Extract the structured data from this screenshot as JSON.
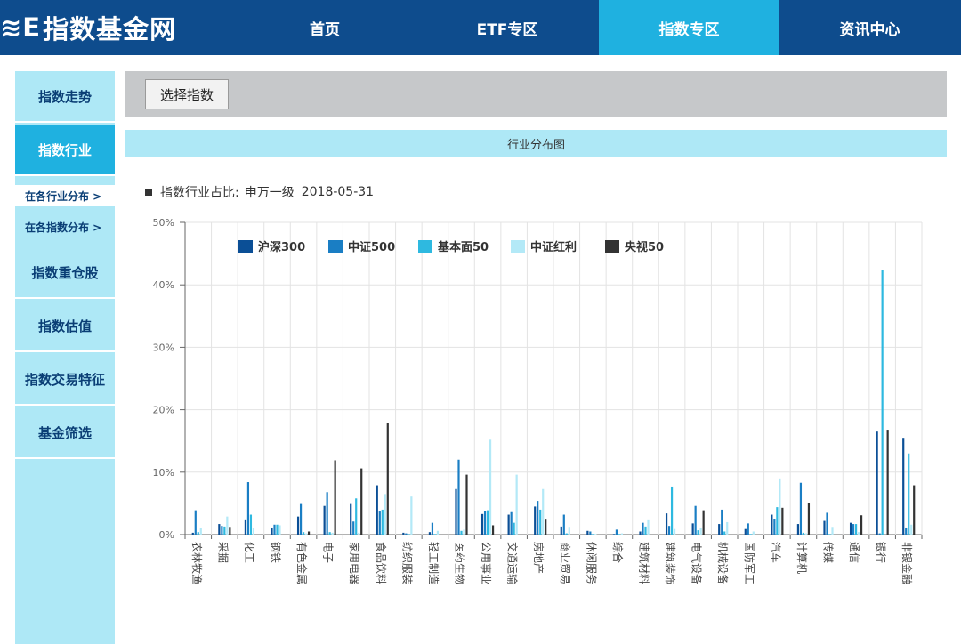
{
  "logo": {
    "mark": "≋E",
    "text": "指数基金网"
  },
  "nav": [
    {
      "label": "首页",
      "active": false
    },
    {
      "label": "ETF专区",
      "active": false
    },
    {
      "label": "指数专区",
      "active": true
    },
    {
      "label": "资讯中心",
      "active": false
    }
  ],
  "sidebar": {
    "items": [
      {
        "label": "指数走势",
        "active": false
      },
      {
        "label": "指数行业",
        "active": true
      },
      {
        "label": "在各行业分布 >",
        "active": true,
        "sub": true
      },
      {
        "label": "在各指数分布 >",
        "active": false,
        "sub": true
      },
      {
        "label": "指数重仓股",
        "active": false
      },
      {
        "label": "指数估值",
        "active": false
      },
      {
        "label": "指数交易特征",
        "active": false
      },
      {
        "label": "基金筛选",
        "active": false
      }
    ]
  },
  "toolbar": {
    "select_label": "选择指数"
  },
  "banner": {
    "title": "行业分布图"
  },
  "subtitle": {
    "label": "指数行业占比:",
    "scheme": "申万一级",
    "date": "2018-05-31"
  },
  "colors": {
    "nav_bg": "#0e4c8d",
    "accent": "#1fb1e0",
    "light": "#aee8f6"
  },
  "chart_data": {
    "type": "bar",
    "ylim": [
      0,
      50
    ],
    "yticks": [
      "0%",
      "10%",
      "20%",
      "30%",
      "40%",
      "50%"
    ],
    "ytick_values": [
      0,
      10,
      20,
      30,
      40,
      50
    ],
    "grid": true,
    "legend_position": "top-left",
    "categories": [
      "农林牧渔",
      "采掘",
      "化工",
      "钢铁",
      "有色金属",
      "电子",
      "家用电器",
      "食品饮料",
      "纺织服装",
      "轻工制造",
      "医药生物",
      "公用事业",
      "交通运输",
      "房地产",
      "商业贸易",
      "休闲服务",
      "综合",
      "建筑材料",
      "建筑装饰",
      "电气设备",
      "机械设备",
      "国防军工",
      "汽车",
      "计算机",
      "传媒",
      "通信",
      "银行",
      "非银金融"
    ],
    "series": [
      {
        "name": "沪深300",
        "color": "#0b4f96",
        "values": [
          0.3,
          1.7,
          2.3,
          1.0,
          2.9,
          4.6,
          4.9,
          7.9,
          0.3,
          0.4,
          7.3,
          3.3,
          3.2,
          4.5,
          1.3,
          0.6,
          0.1,
          0.5,
          3.4,
          1.8,
          1.7,
          0.9,
          3.2,
          1.7,
          2.2,
          1.9,
          16.5,
          15.5
        ]
      },
      {
        "name": "中证500",
        "color": "#1a7ec4",
        "values": [
          3.9,
          1.4,
          8.4,
          1.6,
          4.9,
          6.8,
          2.1,
          3.7,
          0.2,
          1.9,
          12.0,
          3.8,
          3.6,
          5.4,
          3.2,
          0.5,
          0.8,
          1.9,
          1.4,
          4.6,
          4.0,
          1.8,
          2.5,
          8.3,
          3.5,
          1.7,
          0.2,
          1.0
        ]
      },
      {
        "name": "基本面50",
        "color": "#2eb9e0",
        "values": [
          0.4,
          1.3,
          3.2,
          1.6,
          0.4,
          0.4,
          5.8,
          4.0,
          0.1,
          0.1,
          0.6,
          3.9,
          1.9,
          4.0,
          0.2,
          0.1,
          0.1,
          1.3,
          7.7,
          0.7,
          0.5,
          0.1,
          4.4,
          0.3,
          0.1,
          1.7,
          42.4,
          13.0
        ]
      },
      {
        "name": "中证红利",
        "color": "#b3e9f7",
        "values": [
          1.0,
          2.9,
          1.0,
          1.5,
          0.2,
          0.3,
          0.3,
          6.5,
          6.1,
          0.6,
          0.8,
          15.2,
          9.6,
          7.3,
          1.1,
          0.1,
          0.2,
          2.3,
          0.9,
          1.0,
          2.0,
          0.5,
          9.0,
          0.2,
          1.1,
          0.4,
          0.0,
          1.6
        ]
      },
      {
        "name": "央视50",
        "color": "#333333",
        "values": [
          0.0,
          1.1,
          0.0,
          0.0,
          0.5,
          11.9,
          10.6,
          17.9,
          0.0,
          0.0,
          9.6,
          1.5,
          0.0,
          2.4,
          0.0,
          0.0,
          0.0,
          0.0,
          0.0,
          3.9,
          0.0,
          0.0,
          4.3,
          5.1,
          0.0,
          3.1,
          16.8,
          7.9
        ]
      }
    ]
  }
}
